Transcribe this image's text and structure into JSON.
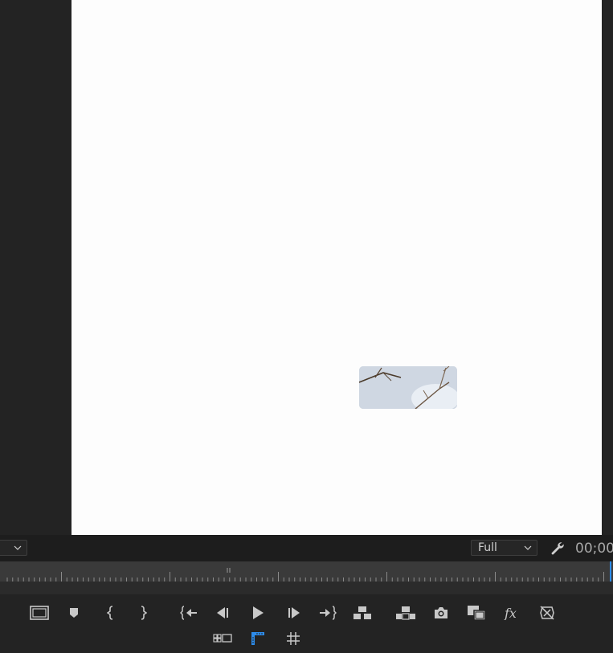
{
  "monitor": {
    "quality_dropdown": {
      "value": "Full"
    },
    "timecode": "00;00",
    "left_dropdown": {
      "value": ""
    }
  },
  "colors": {
    "panel_bg": "#232323",
    "canvas_bg": "#fdfdfd",
    "icon": "#c8c8c8",
    "accent_blue": "#2d8ceb"
  },
  "transport": {
    "row1": [
      "safe-margins-icon",
      "add-marker-icon",
      "mark-in-icon",
      "mark-out-icon",
      "go-to-in-icon",
      "step-back-icon",
      "play-icon",
      "step-forward-icon",
      "go-to-out-icon",
      "insert-icon",
      "overwrite-icon",
      "export-frame-icon",
      "comparison-view-icon",
      "fx-icon",
      "toggle-proxies-icon"
    ],
    "row2": [
      "multicam-view-icon",
      "show-rulers-icon",
      "show-guides-icon"
    ]
  }
}
